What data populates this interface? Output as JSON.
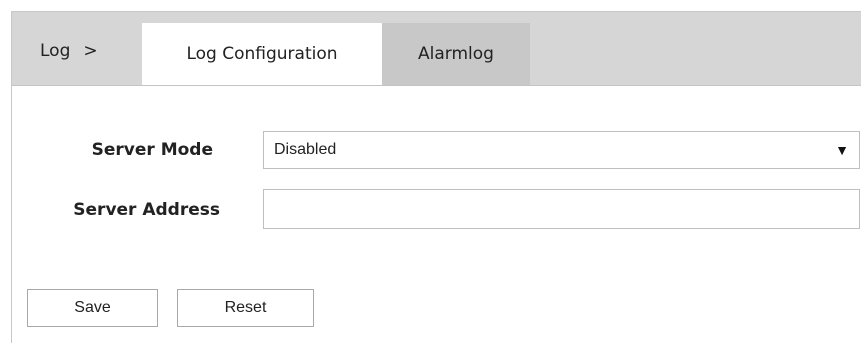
{
  "breadcrumb": {
    "root": "Log",
    "separator": ">"
  },
  "tabs": [
    {
      "label": "Log Configuration",
      "active": true
    },
    {
      "label": "Alarmlog",
      "active": false
    }
  ],
  "form": {
    "server_mode": {
      "label": "Server Mode",
      "value": "Disabled",
      "arrow": "▼"
    },
    "server_address": {
      "label": "Server Address",
      "value": "",
      "placeholder": ""
    }
  },
  "buttons": {
    "save": "Save",
    "reset": "Reset"
  },
  "colors": {
    "tabbar_bg": "#d6d6d6",
    "tab_active_bg": "#ffffff",
    "tab_inactive_bg": "#c8c8c8"
  }
}
